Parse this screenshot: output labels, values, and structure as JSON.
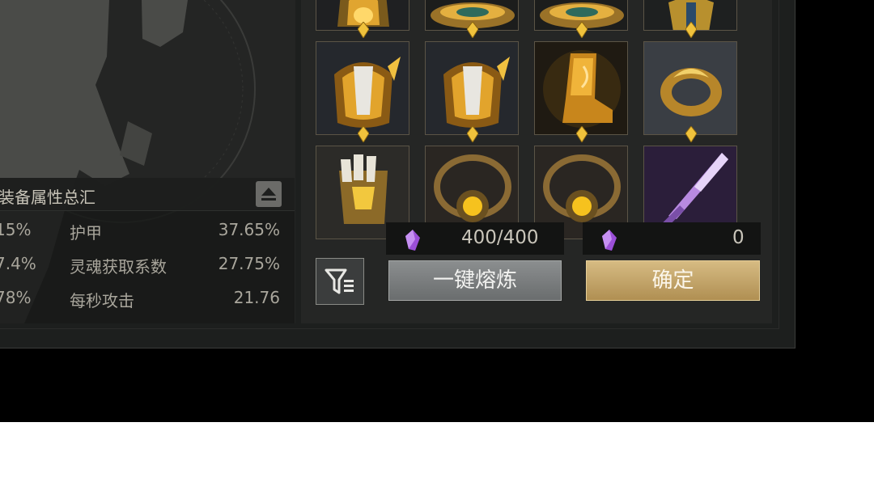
{
  "stats_panel": {
    "title": "装备属性总汇",
    "collapse_icon": "eject-icon",
    "rows": [
      {
        "left_value": "15%",
        "name": "护甲",
        "value": "37.65%"
      },
      {
        "left_value": "7.4%",
        "name": "灵魂获取系数",
        "value": "27.75%"
      },
      {
        "left_value": "78%",
        "name": "每秒攻击",
        "value": "21.76"
      }
    ]
  },
  "inventory": {
    "rows": [
      [
        "helmet-icon",
        "hat-icon",
        "hat-icon",
        "armor-icon"
      ],
      [
        "pauldron-icon",
        "pauldron-icon",
        "boot-icon",
        "ring-icon"
      ],
      [
        "gauntlet-icon",
        "necklace-icon",
        "necklace-icon",
        "sword-icon"
      ]
    ]
  },
  "resources": {
    "crystal_icon": "purple-crystal-icon",
    "capacity": "400/400",
    "amount": "0"
  },
  "buttons": {
    "filter_icon": "filter-icon",
    "smelt": "一键熔炼",
    "confirm": "确定"
  },
  "colors": {
    "gold": "#e8b23a",
    "confirm_button": "#c8a86b",
    "smelt_button": "#7c7f80",
    "crystal": "#9b4fd8"
  }
}
